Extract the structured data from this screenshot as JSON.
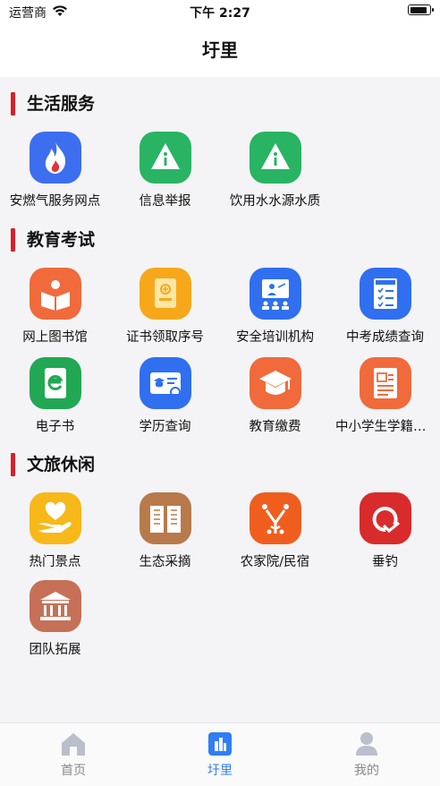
{
  "status_bar": {
    "carrier": "运营商",
    "time": "下午 2:27"
  },
  "header": {
    "title": "圩里"
  },
  "sections": [
    {
      "title": "生活服务",
      "items": [
        {
          "label": "安燃气服务网点",
          "icon": "flame-icon",
          "color": "#3d6ef0"
        },
        {
          "label": "信息举报",
          "icon": "info-icon",
          "color": "#28b463"
        },
        {
          "label": "饮用水水源水质",
          "icon": "info-icon",
          "color": "#28b463"
        }
      ]
    },
    {
      "title": "教育考试",
      "items": [
        {
          "label": "网上图书馆",
          "icon": "book-icon",
          "color": "#f06a3b"
        },
        {
          "label": "证书领取序号",
          "icon": "certificate-icon",
          "color": "#f7a81a"
        },
        {
          "label": "安全培训机构",
          "icon": "training-icon",
          "color": "#2f6ff0"
        },
        {
          "label": "中考成绩查询",
          "icon": "exam-report-icon",
          "color": "#2f6ff0"
        },
        {
          "label": "电子书",
          "icon": "ebook-icon",
          "color": "#22a855"
        },
        {
          "label": "学历查询",
          "icon": "degree-card-icon",
          "color": "#2f6ff0"
        },
        {
          "label": "教育缴费",
          "icon": "graduation-cap-icon",
          "color": "#f06a3b"
        },
        {
          "label": "中小学生学籍查询",
          "icon": "document-icon",
          "color": "#f06a3b"
        }
      ]
    },
    {
      "title": "文旅休闲",
      "items": [
        {
          "label": "热门景点",
          "icon": "heart-hand-icon",
          "color": "#f7b81a"
        },
        {
          "label": "生态采摘",
          "icon": "open-book-icon",
          "color": "#b87a4b"
        },
        {
          "label": "农家院/民宿",
          "icon": "fruit-tree-icon",
          "color": "#ef5e1e"
        },
        {
          "label": "垂钓",
          "icon": "fishing-icon",
          "color": "#d92b2b"
        },
        {
          "label": "团队拓展",
          "icon": "museum-icon",
          "color": "#c67058"
        }
      ]
    }
  ],
  "tab_bar": [
    {
      "label": "首页",
      "icon": "home-icon",
      "active": false
    },
    {
      "label": "圩里",
      "icon": "building-icon",
      "active": true
    },
    {
      "label": "我的",
      "icon": "person-icon",
      "active": false
    }
  ],
  "colors": {
    "accent_bar": "#d7202a",
    "active_tab": "#2f7ef7"
  }
}
